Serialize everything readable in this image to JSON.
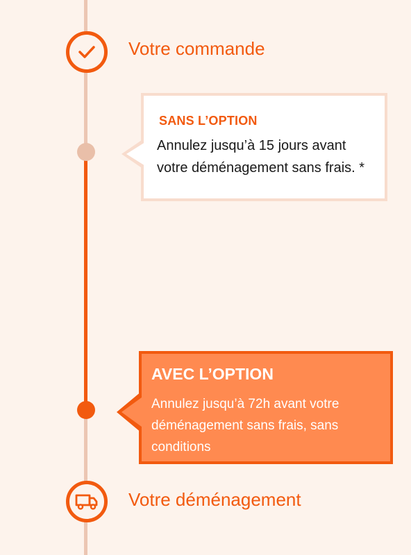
{
  "colors": {
    "accent": "#f25a0f",
    "accent_light": "#ff8a50",
    "timeline_inactive": "#ecc6b3",
    "background": "#fdf3ec"
  },
  "steps": {
    "start": {
      "label": "Votre commande",
      "icon": "check-icon"
    },
    "end": {
      "label": "Votre déménagement",
      "icon": "truck-icon"
    }
  },
  "without_option": {
    "title": "SANS L’OPTION",
    "text": "Annulez jusqu’à 15 jours avant votre déménagement sans frais. *"
  },
  "with_option": {
    "title": "AVEC L’OPTION",
    "text": "Annulez jusqu’à 72h avant votre déménagement sans frais, sans conditions"
  }
}
